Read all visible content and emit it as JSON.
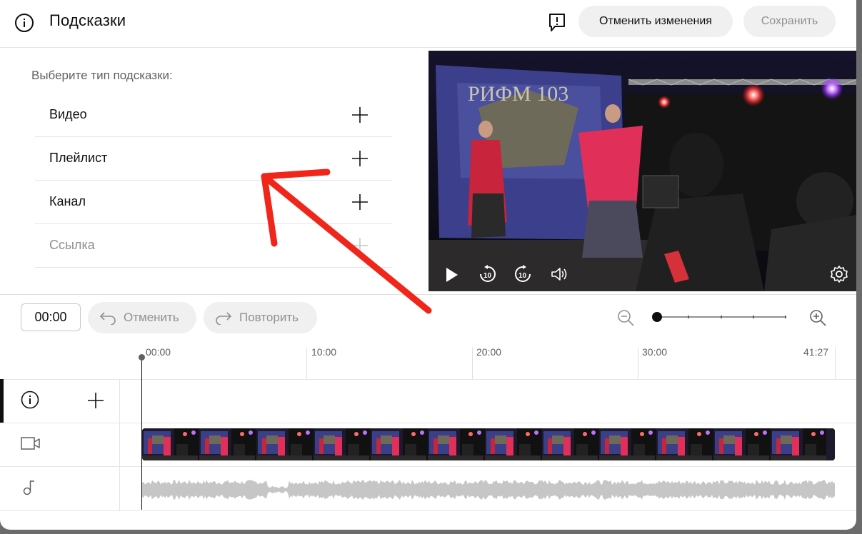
{
  "header": {
    "title": "Подсказки",
    "discard_label": "Отменить изменения",
    "save_label": "Сохранить"
  },
  "card_types": {
    "prompt": "Выберите тип подсказки:",
    "items": [
      {
        "label": "Видео",
        "enabled": true
      },
      {
        "label": "Плейлист",
        "enabled": true
      },
      {
        "label": "Канал",
        "enabled": true
      },
      {
        "label": "Ссылка",
        "enabled": false
      }
    ]
  },
  "player": {
    "controls": [
      "play-icon",
      "rewind-10-icon",
      "forward-10-icon",
      "volume-icon",
      "settings-gear-icon"
    ]
  },
  "toolbar": {
    "current_time": "00:00",
    "undo_label": "Отменить",
    "redo_label": "Повторить",
    "zoom_level": 0
  },
  "timeline": {
    "ruler": [
      "00:00",
      "10:00",
      "20:00",
      "30:00",
      "41:27"
    ]
  },
  "colors": {
    "accent_black": "#0f0f0f",
    "button_gray": "#f0f0f0",
    "annotation_arrow": "#f0261b",
    "disabled_text": "#909090"
  }
}
